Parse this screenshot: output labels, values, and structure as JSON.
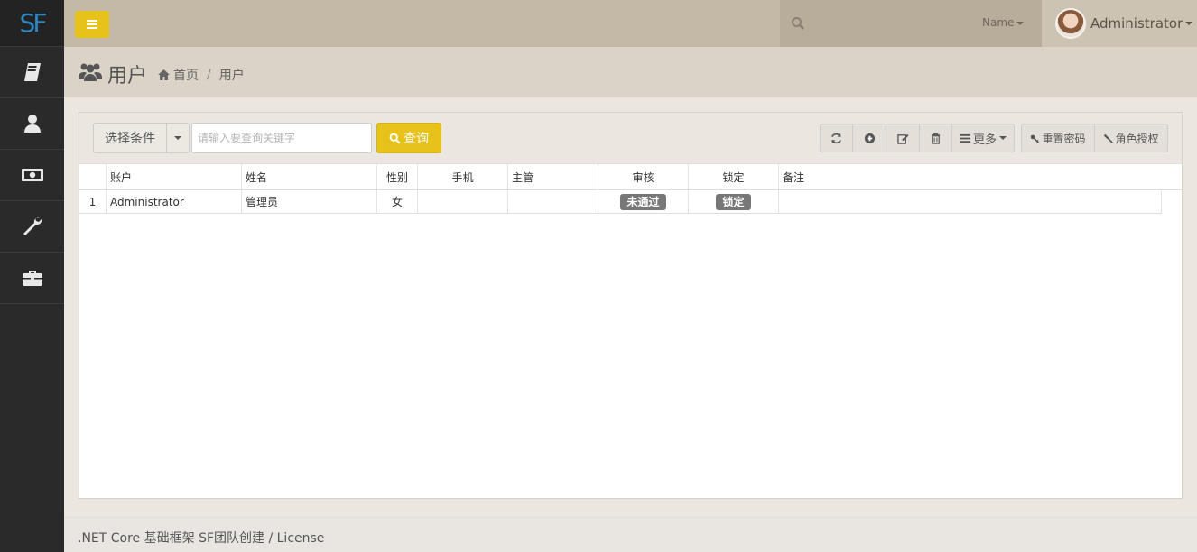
{
  "brand": {
    "logo_text": "SF"
  },
  "sidebar": {
    "items": [
      {
        "icon": "book-icon"
      },
      {
        "icon": "user-icon"
      },
      {
        "icon": "money-icon"
      },
      {
        "icon": "wrench-icon"
      },
      {
        "icon": "briefcase-icon"
      }
    ]
  },
  "topbar": {
    "search_placeholder": "",
    "name_dropdown": "Name",
    "user_name": "Administrator"
  },
  "page": {
    "title": "用户",
    "breadcrumb": {
      "home": "首页",
      "current": "用户"
    }
  },
  "toolbar": {
    "condition_label": "选择条件",
    "keyword_placeholder": "请输入要查询关键字",
    "query_label": "查询",
    "more_label": "更多",
    "reset_password_label": "重置密码",
    "role_auth_label": "角色授权"
  },
  "table": {
    "columns": [
      "",
      "账户",
      "姓名",
      "性别",
      "手机",
      "主管",
      "审核",
      "锁定",
      "备注"
    ],
    "rows": [
      {
        "index": "1",
        "account": "Administrator",
        "name": "管理员",
        "sex": "女",
        "phone": "",
        "manager": "",
        "audit": "未通过",
        "lock": "锁定",
        "note": ""
      }
    ]
  },
  "footer": {
    "text": ".NET Core 基础框架 SF团队创建 / License"
  },
  "colors": {
    "accent": "#e6c21b",
    "sidebar": "#2a2a2a",
    "topbar": "#c4b9a6",
    "logo": "#2e86c1"
  }
}
